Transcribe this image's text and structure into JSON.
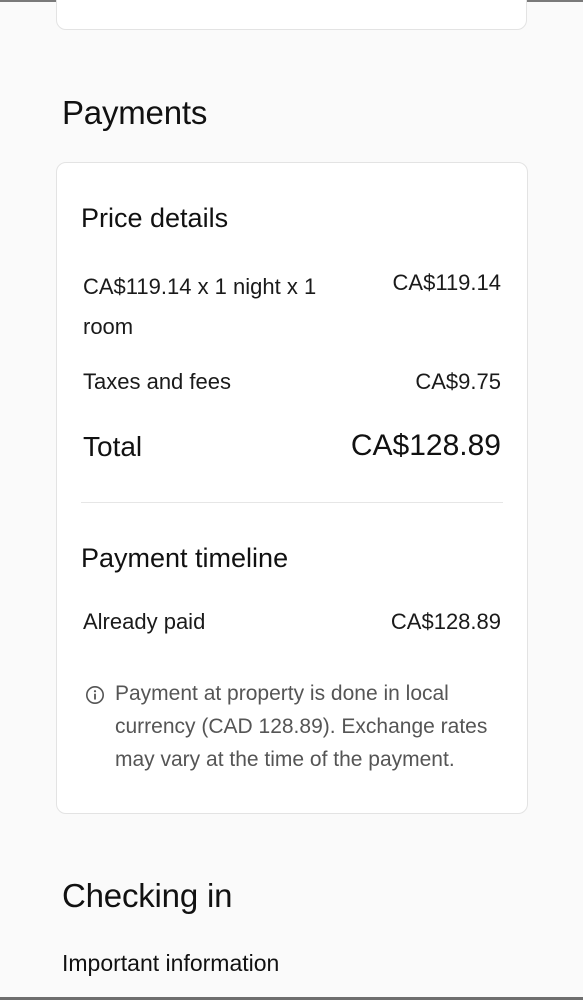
{
  "payments": {
    "section_title": "Payments",
    "price_details": {
      "heading": "Price details",
      "nightly_label": "CA$119.14 x 1 night x 1 room",
      "nightly_value": "CA$119.14",
      "taxes_label": "Taxes and fees",
      "taxes_value": "CA$9.75",
      "total_label": "Total",
      "total_value": "CA$128.89"
    },
    "timeline": {
      "heading": "Payment timeline",
      "paid_label": "Already paid",
      "paid_value": "CA$128.89",
      "info_icon": "info-circle-icon",
      "info_text": "Payment at property is done in local currency (CAD 128.89). Exchange rates may vary at the time of the payment."
    }
  },
  "checkin": {
    "section_title": "Checking in",
    "important_info": "Important information"
  }
}
